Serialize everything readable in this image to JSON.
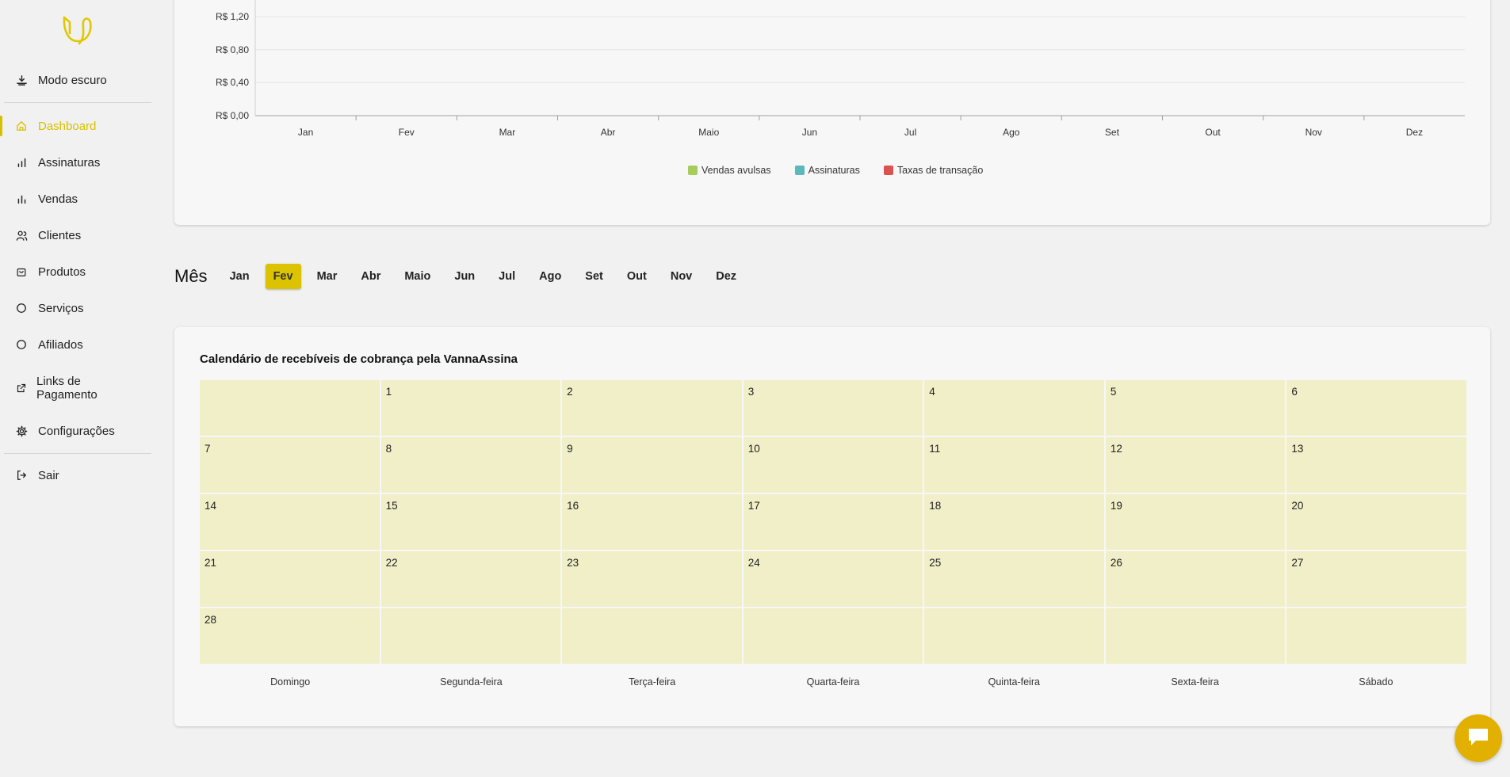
{
  "sidebar": {
    "dark_mode": "Modo escuro",
    "items": [
      {
        "label": "Dashboard",
        "icon": "home-icon",
        "active": true
      },
      {
        "label": "Assinaturas",
        "icon": "bar-chart-icon"
      },
      {
        "label": "Vendas",
        "icon": "bar-chart-icon"
      },
      {
        "label": "Clientes",
        "icon": "users-icon"
      },
      {
        "label": "Produtos",
        "icon": "bag-icon"
      },
      {
        "label": "Serviços",
        "icon": "circle-icon"
      },
      {
        "label": "Afiliados",
        "icon": "circle-icon"
      },
      {
        "label": "Links de Pagamento",
        "icon": "external-link-icon"
      },
      {
        "label": "Configurações",
        "icon": "gear-icon"
      }
    ],
    "logout": "Sair"
  },
  "chart_data": {
    "type": "bar",
    "categories": [
      "Jan",
      "Fev",
      "Mar",
      "Abr",
      "Maio",
      "Jun",
      "Jul",
      "Ago",
      "Set",
      "Out",
      "Nov",
      "Dez"
    ],
    "series": [
      {
        "name": "Vendas avulsas",
        "values": [
          0,
          0,
          0,
          0,
          0,
          0,
          0,
          0,
          0,
          0,
          0,
          0
        ],
        "color": "#a8cc5c"
      },
      {
        "name": "Assinaturas",
        "values": [
          0,
          0,
          0,
          0,
          0,
          0,
          0,
          0,
          0,
          0,
          0,
          0
        ],
        "color": "#5cb8bc"
      },
      {
        "name": "Taxas de transação",
        "values": [
          0,
          0,
          0,
          0,
          0,
          0,
          0,
          0,
          0,
          0,
          0,
          0
        ],
        "color": "#d9534f"
      }
    ],
    "y_tick_labels": [
      "R$ 0,00",
      "R$ 0,40",
      "R$ 0,80",
      "R$ 1,20"
    ],
    "ylim": [
      0,
      1.6
    ],
    "grid": true,
    "legend": "bottom-center"
  },
  "month_selector": {
    "title": "Mês",
    "months": [
      "Jan",
      "Fev",
      "Mar",
      "Abr",
      "Maio",
      "Jun",
      "Jul",
      "Ago",
      "Set",
      "Out",
      "Nov",
      "Dez"
    ],
    "selected": "Fev"
  },
  "calendar": {
    "title": "Calendário de recebíveis de cobrança pela VannaAssina",
    "days": [
      "",
      "1",
      "2",
      "3",
      "4",
      "5",
      "6",
      "7",
      "8",
      "9",
      "10",
      "11",
      "12",
      "13",
      "14",
      "15",
      "16",
      "17",
      "18",
      "19",
      "20",
      "21",
      "22",
      "23",
      "24",
      "25",
      "26",
      "27",
      "28",
      "",
      "",
      "",
      "",
      "",
      ""
    ],
    "weekdays": [
      "Domingo",
      "Segunda-feira",
      "Terça-feira",
      "Quarta-feira",
      "Quinta-feira",
      "Sexta-feira",
      "Sábado"
    ],
    "cell_color": "#f0efc8"
  },
  "colors": {
    "accent": "#d8c000",
    "chat": "#e2b000"
  }
}
